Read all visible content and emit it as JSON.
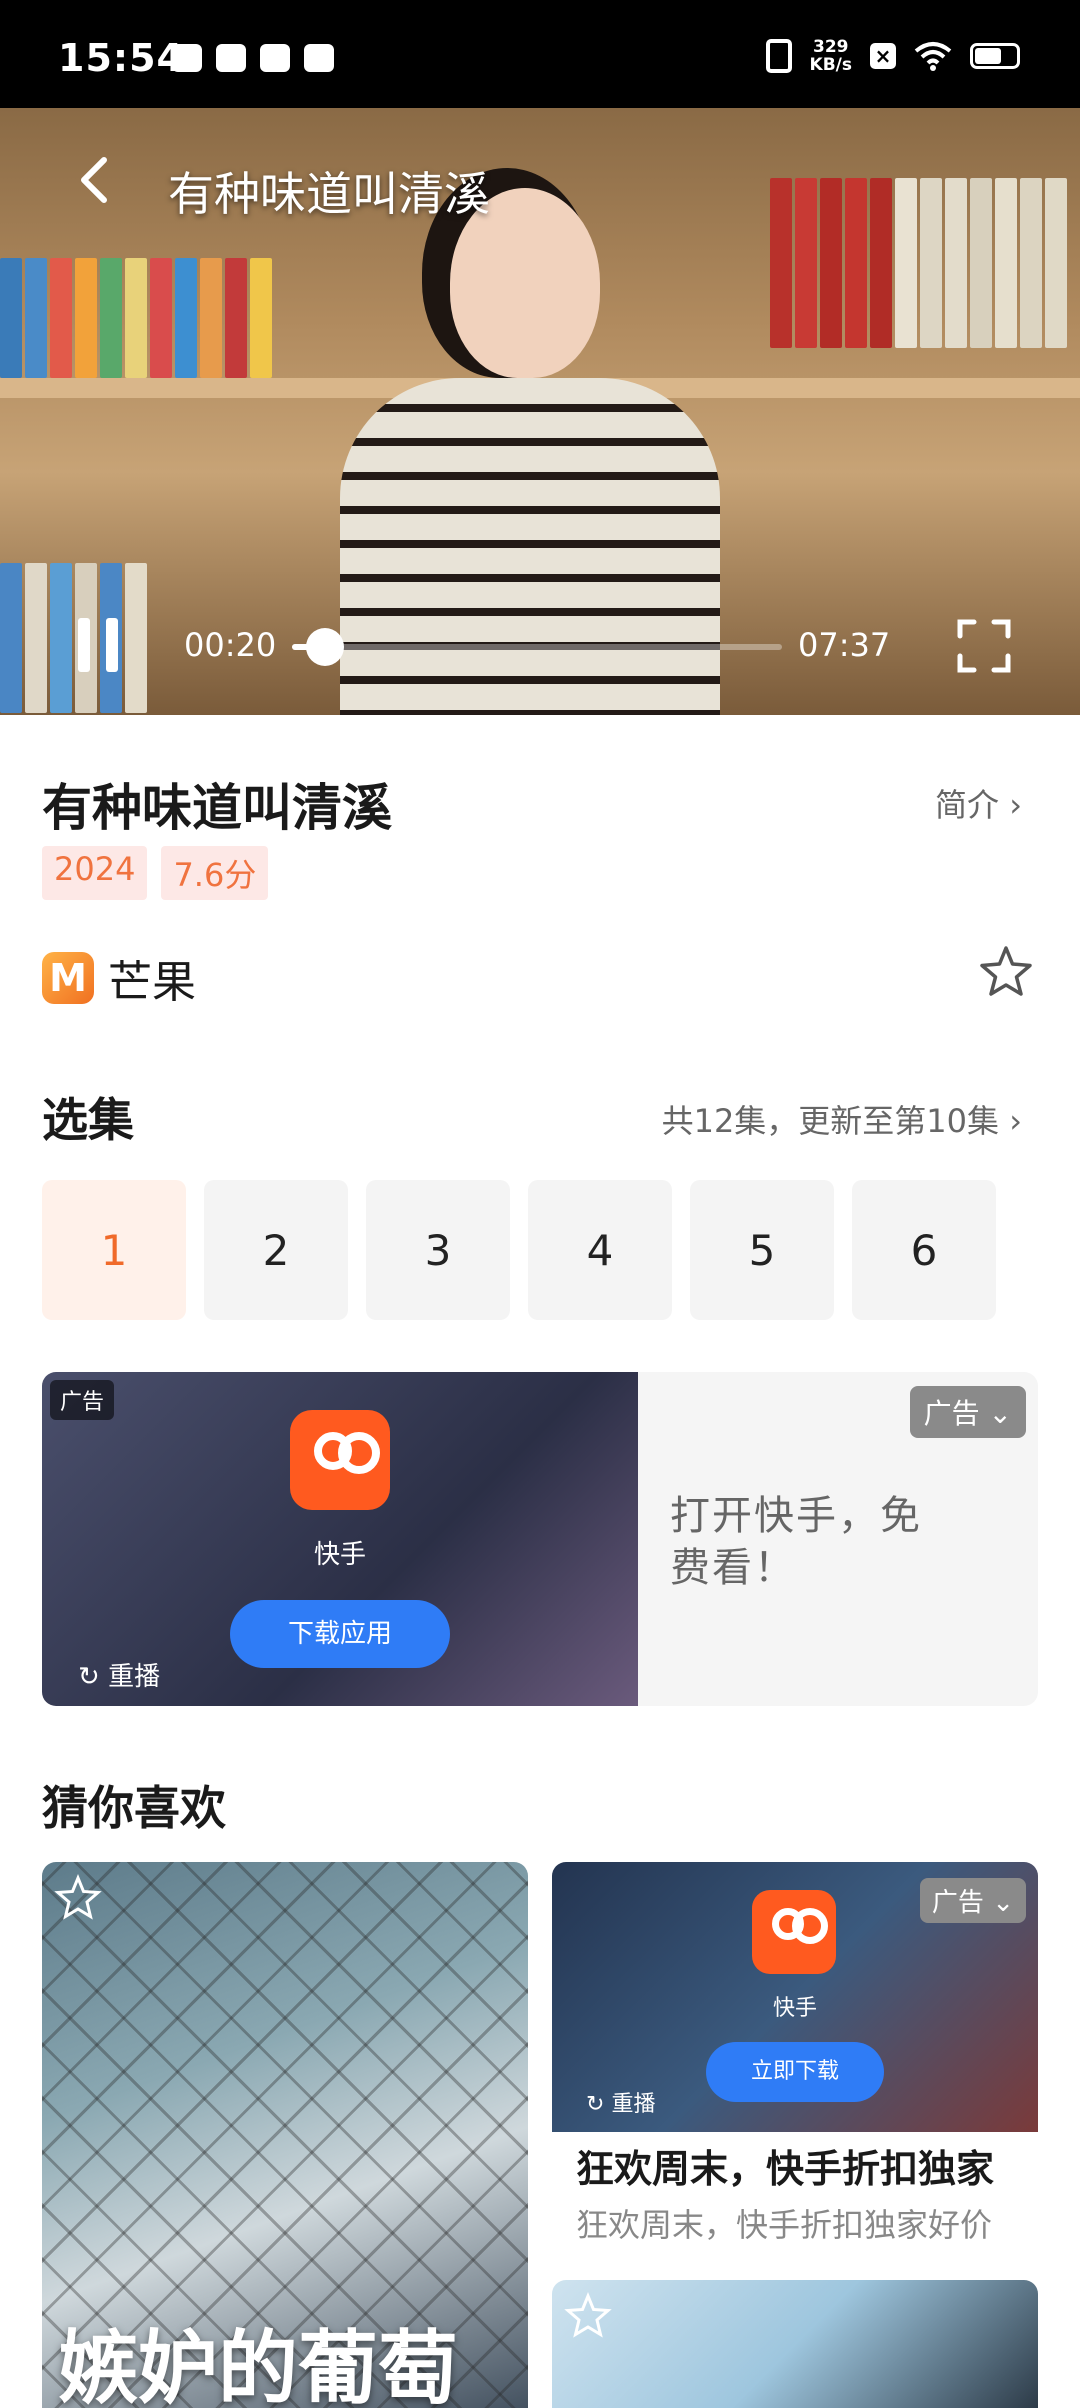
{
  "status_bar": {
    "time": "15:54",
    "net_speed_value": "329",
    "net_speed_unit": "KB/s"
  },
  "video": {
    "title": "有种味道叫清溪",
    "current_time": "00:20",
    "total_time": "07:37",
    "progress": 0.045
  },
  "info": {
    "title": "有种味道叫清溪",
    "intro_label": "简介",
    "tags": [
      "2024",
      "7.6分"
    ],
    "source_name": "芒果",
    "source_logo_letter": "M"
  },
  "episodes": {
    "heading": "选集",
    "summary": "共12集，更新至第10集",
    "items": [
      "1",
      "2",
      "3",
      "4",
      "5",
      "6"
    ],
    "active": "1"
  },
  "ad_banner": {
    "badge": "广告",
    "app_name": "快手",
    "download_label": "下载应用",
    "replay_label": "重播",
    "text": "打开快手，免费看！",
    "ad_tag": "广告"
  },
  "guess": {
    "heading": "猜你喜欢",
    "big_card_title": "嫉妒的葡萄",
    "ad_card": {
      "app_name": "快手",
      "download_label": "立即下载",
      "replay_label": "重播",
      "ad_tag": "广告",
      "title": "狂欢周末，快手折扣独家",
      "subtitle": "狂欢周末，快手折扣独家好价"
    }
  }
}
